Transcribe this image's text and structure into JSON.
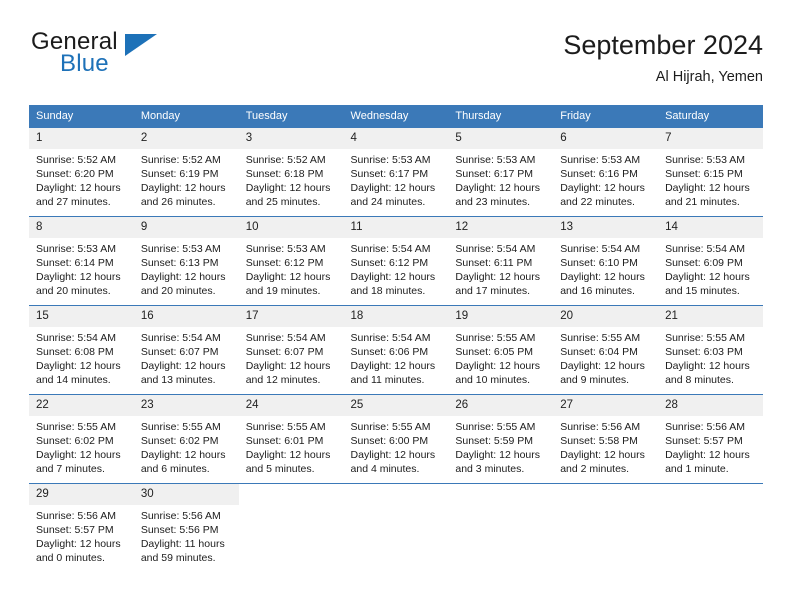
{
  "brand": {
    "name_part1": "General",
    "name_part2": "Blue",
    "triangle_color": "#1d71b8"
  },
  "header": {
    "title": "September 2024",
    "subtitle": "Al Hijrah, Yemen"
  },
  "colors": {
    "header_blue": "#3b79b8",
    "daynum_background": "#f0f0f0",
    "text": "#1c1c1c"
  },
  "weekday_headers": [
    "Sunday",
    "Monday",
    "Tuesday",
    "Wednesday",
    "Thursday",
    "Friday",
    "Saturday"
  ],
  "weeks": [
    [
      {
        "day": "1",
        "sunrise": "Sunrise: 5:52 AM",
        "sunset": "Sunset: 6:20 PM",
        "daylight_line1": "Daylight: 12 hours",
        "daylight_line2": "and 27 minutes."
      },
      {
        "day": "2",
        "sunrise": "Sunrise: 5:52 AM",
        "sunset": "Sunset: 6:19 PM",
        "daylight_line1": "Daylight: 12 hours",
        "daylight_line2": "and 26 minutes."
      },
      {
        "day": "3",
        "sunrise": "Sunrise: 5:52 AM",
        "sunset": "Sunset: 6:18 PM",
        "daylight_line1": "Daylight: 12 hours",
        "daylight_line2": "and 25 minutes."
      },
      {
        "day": "4",
        "sunrise": "Sunrise: 5:53 AM",
        "sunset": "Sunset: 6:17 PM",
        "daylight_line1": "Daylight: 12 hours",
        "daylight_line2": "and 24 minutes."
      },
      {
        "day": "5",
        "sunrise": "Sunrise: 5:53 AM",
        "sunset": "Sunset: 6:17 PM",
        "daylight_line1": "Daylight: 12 hours",
        "daylight_line2": "and 23 minutes."
      },
      {
        "day": "6",
        "sunrise": "Sunrise: 5:53 AM",
        "sunset": "Sunset: 6:16 PM",
        "daylight_line1": "Daylight: 12 hours",
        "daylight_line2": "and 22 minutes."
      },
      {
        "day": "7",
        "sunrise": "Sunrise: 5:53 AM",
        "sunset": "Sunset: 6:15 PM",
        "daylight_line1": "Daylight: 12 hours",
        "daylight_line2": "and 21 minutes."
      }
    ],
    [
      {
        "day": "8",
        "sunrise": "Sunrise: 5:53 AM",
        "sunset": "Sunset: 6:14 PM",
        "daylight_line1": "Daylight: 12 hours",
        "daylight_line2": "and 20 minutes."
      },
      {
        "day": "9",
        "sunrise": "Sunrise: 5:53 AM",
        "sunset": "Sunset: 6:13 PM",
        "daylight_line1": "Daylight: 12 hours",
        "daylight_line2": "and 20 minutes."
      },
      {
        "day": "10",
        "sunrise": "Sunrise: 5:53 AM",
        "sunset": "Sunset: 6:12 PM",
        "daylight_line1": "Daylight: 12 hours",
        "daylight_line2": "and 19 minutes."
      },
      {
        "day": "11",
        "sunrise": "Sunrise: 5:54 AM",
        "sunset": "Sunset: 6:12 PM",
        "daylight_line1": "Daylight: 12 hours",
        "daylight_line2": "and 18 minutes."
      },
      {
        "day": "12",
        "sunrise": "Sunrise: 5:54 AM",
        "sunset": "Sunset: 6:11 PM",
        "daylight_line1": "Daylight: 12 hours",
        "daylight_line2": "and 17 minutes."
      },
      {
        "day": "13",
        "sunrise": "Sunrise: 5:54 AM",
        "sunset": "Sunset: 6:10 PM",
        "daylight_line1": "Daylight: 12 hours",
        "daylight_line2": "and 16 minutes."
      },
      {
        "day": "14",
        "sunrise": "Sunrise: 5:54 AM",
        "sunset": "Sunset: 6:09 PM",
        "daylight_line1": "Daylight: 12 hours",
        "daylight_line2": "and 15 minutes."
      }
    ],
    [
      {
        "day": "15",
        "sunrise": "Sunrise: 5:54 AM",
        "sunset": "Sunset: 6:08 PM",
        "daylight_line1": "Daylight: 12 hours",
        "daylight_line2": "and 14 minutes."
      },
      {
        "day": "16",
        "sunrise": "Sunrise: 5:54 AM",
        "sunset": "Sunset: 6:07 PM",
        "daylight_line1": "Daylight: 12 hours",
        "daylight_line2": "and 13 minutes."
      },
      {
        "day": "17",
        "sunrise": "Sunrise: 5:54 AM",
        "sunset": "Sunset: 6:07 PM",
        "daylight_line1": "Daylight: 12 hours",
        "daylight_line2": "and 12 minutes."
      },
      {
        "day": "18",
        "sunrise": "Sunrise: 5:54 AM",
        "sunset": "Sunset: 6:06 PM",
        "daylight_line1": "Daylight: 12 hours",
        "daylight_line2": "and 11 minutes."
      },
      {
        "day": "19",
        "sunrise": "Sunrise: 5:55 AM",
        "sunset": "Sunset: 6:05 PM",
        "daylight_line1": "Daylight: 12 hours",
        "daylight_line2": "and 10 minutes."
      },
      {
        "day": "20",
        "sunrise": "Sunrise: 5:55 AM",
        "sunset": "Sunset: 6:04 PM",
        "daylight_line1": "Daylight: 12 hours",
        "daylight_line2": "and 9 minutes."
      },
      {
        "day": "21",
        "sunrise": "Sunrise: 5:55 AM",
        "sunset": "Sunset: 6:03 PM",
        "daylight_line1": "Daylight: 12 hours",
        "daylight_line2": "and 8 minutes."
      }
    ],
    [
      {
        "day": "22",
        "sunrise": "Sunrise: 5:55 AM",
        "sunset": "Sunset: 6:02 PM",
        "daylight_line1": "Daylight: 12 hours",
        "daylight_line2": "and 7 minutes."
      },
      {
        "day": "23",
        "sunrise": "Sunrise: 5:55 AM",
        "sunset": "Sunset: 6:02 PM",
        "daylight_line1": "Daylight: 12 hours",
        "daylight_line2": "and 6 minutes."
      },
      {
        "day": "24",
        "sunrise": "Sunrise: 5:55 AM",
        "sunset": "Sunset: 6:01 PM",
        "daylight_line1": "Daylight: 12 hours",
        "daylight_line2": "and 5 minutes."
      },
      {
        "day": "25",
        "sunrise": "Sunrise: 5:55 AM",
        "sunset": "Sunset: 6:00 PM",
        "daylight_line1": "Daylight: 12 hours",
        "daylight_line2": "and 4 minutes."
      },
      {
        "day": "26",
        "sunrise": "Sunrise: 5:55 AM",
        "sunset": "Sunset: 5:59 PM",
        "daylight_line1": "Daylight: 12 hours",
        "daylight_line2": "and 3 minutes."
      },
      {
        "day": "27",
        "sunrise": "Sunrise: 5:56 AM",
        "sunset": "Sunset: 5:58 PM",
        "daylight_line1": "Daylight: 12 hours",
        "daylight_line2": "and 2 minutes."
      },
      {
        "day": "28",
        "sunrise": "Sunrise: 5:56 AM",
        "sunset": "Sunset: 5:57 PM",
        "daylight_line1": "Daylight: 12 hours",
        "daylight_line2": "and 1 minute."
      }
    ],
    [
      {
        "day": "29",
        "sunrise": "Sunrise: 5:56 AM",
        "sunset": "Sunset: 5:57 PM",
        "daylight_line1": "Daylight: 12 hours",
        "daylight_line2": "and 0 minutes."
      },
      {
        "day": "30",
        "sunrise": "Sunrise: 5:56 AM",
        "sunset": "Sunset: 5:56 PM",
        "daylight_line1": "Daylight: 11 hours",
        "daylight_line2": "and 59 minutes."
      },
      {
        "day": "",
        "sunrise": "",
        "sunset": "",
        "daylight_line1": "",
        "daylight_line2": ""
      },
      {
        "day": "",
        "sunrise": "",
        "sunset": "",
        "daylight_line1": "",
        "daylight_line2": ""
      },
      {
        "day": "",
        "sunrise": "",
        "sunset": "",
        "daylight_line1": "",
        "daylight_line2": ""
      },
      {
        "day": "",
        "sunrise": "",
        "sunset": "",
        "daylight_line1": "",
        "daylight_line2": ""
      },
      {
        "day": "",
        "sunrise": "",
        "sunset": "",
        "daylight_line1": "",
        "daylight_line2": ""
      }
    ]
  ]
}
